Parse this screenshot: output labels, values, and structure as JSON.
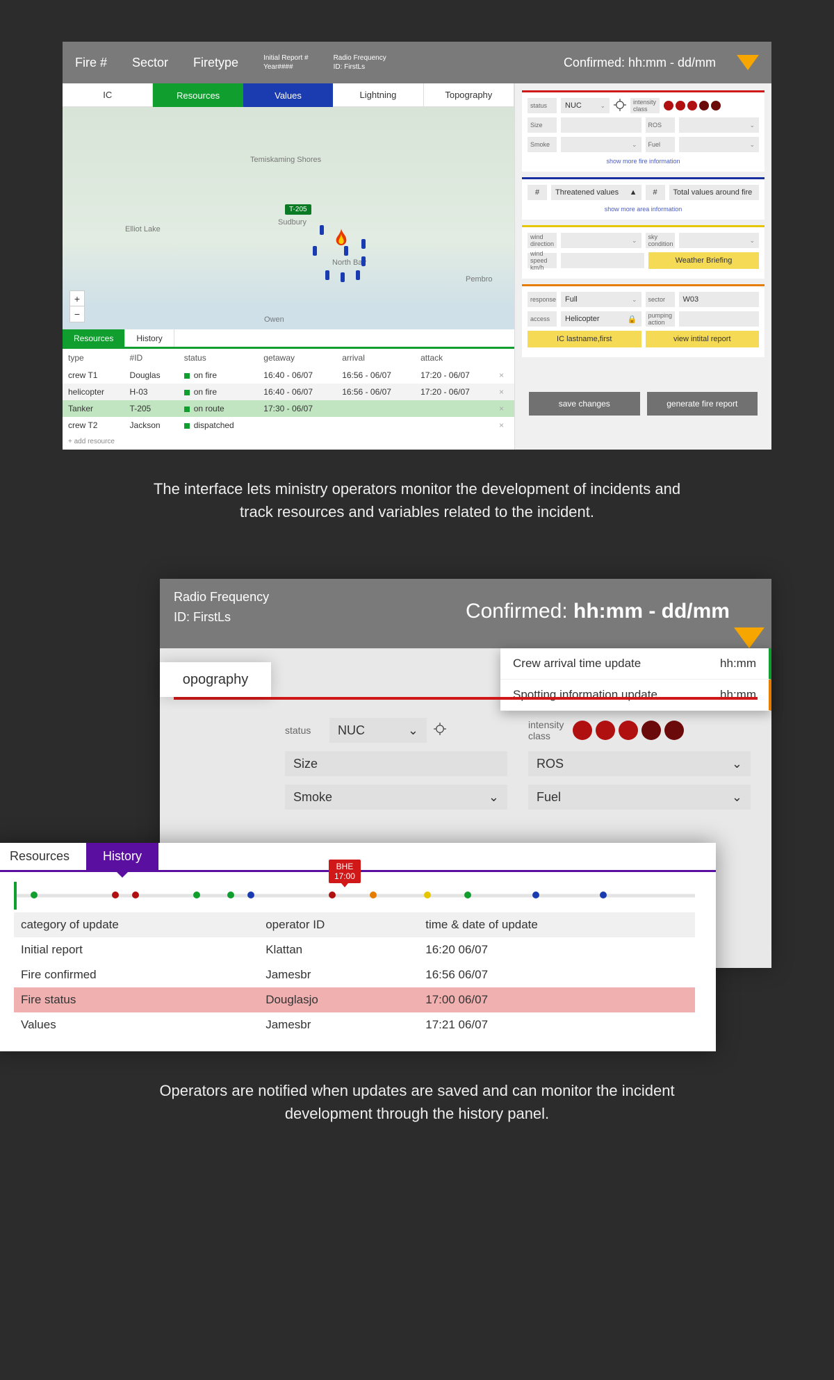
{
  "shot1": {
    "header": {
      "fire": "Fire #",
      "sector": "Sector",
      "firetype": "Firetype",
      "initrep_l1": "Initial Report #",
      "initrep_l2": "Year####",
      "radio_l1": "Radio Frequency",
      "radio_l2": "ID: FirstLs",
      "confirmed": "Confirmed: hh:mm - dd/mm"
    },
    "tabs": [
      "IC",
      "Resources",
      "Values",
      "Lightning",
      "Topography"
    ],
    "map": {
      "temisk": "Temiskaming Shores",
      "sudbury": "Sudbury",
      "elliot": "Elliot Lake",
      "north": "North Bay",
      "pembr": "Pembro",
      "owen": "Owen",
      "tag": "T-205"
    },
    "subtabs": [
      "Resources",
      "History"
    ],
    "columns": [
      "type",
      "#ID",
      "status",
      "getaway",
      "arrival",
      "attack"
    ],
    "rows": [
      {
        "type": "crew T1",
        "id": "Douglas",
        "status": "on fire",
        "getaway": "16:40 - 06/07",
        "arrival": "16:56 - 06/07",
        "attack": "17:20 - 06/07"
      },
      {
        "type": "helicopter",
        "id": "H-03",
        "status": "on fire",
        "getaway": "16:40 - 06/07",
        "arrival": "16:56 - 06/07",
        "attack": "17:20 - 06/07"
      },
      {
        "type": "Tanker",
        "id": "T-205",
        "status": "on route",
        "getaway": "17:30 - 06/07",
        "arrival": "",
        "attack": ""
      },
      {
        "type": "crew T2",
        "id": "Jackson",
        "status": "dispatched",
        "getaway": "",
        "arrival": "",
        "attack": ""
      }
    ],
    "addres": "+ add resource",
    "right": {
      "status_label": "status",
      "status_val": "NUC",
      "intensity_label": "intensity class",
      "size": "Size",
      "ros": "ROS",
      "smoke": "Smoke",
      "fuel": "Fuel",
      "more_fire": "show more fire information",
      "hash": "#",
      "threatened": "Threatened values",
      "total": "Total values around fire",
      "more_area": "show more area information",
      "wind_dir": "wind direction",
      "sky": "sky condition",
      "wind_speed": "wind speed km/h",
      "weather_briefing": "Weather Briefing",
      "response": "response",
      "response_val": "Full",
      "sector": "sector",
      "sector_val": "W03",
      "access": "access",
      "access_val": "Helicopter",
      "pumping": "pumping action",
      "ic": "IC lastname,first",
      "viewrep": "view intital report",
      "save": "save changes",
      "gen": "generate fire report"
    }
  },
  "caption1": "The interface lets ministry operators monitor the development of incidents and track resources and variables related to the incident.",
  "shot2": {
    "radio_l1": "Radio Frequency",
    "radio_l2": "ID: FirstLs",
    "confirmed": "Confirmed: hh:mm - dd/mm",
    "topo": "opography",
    "notif": [
      {
        "t": "Crew arrival time update",
        "v": "hh:mm"
      },
      {
        "t": "Spotting information update",
        "v": "hh:mm"
      }
    ],
    "status_label": "status",
    "status_val": "NUC",
    "intensity_label": "intensity class",
    "size": "Size",
    "ros": "ROS",
    "smoke": "Smoke",
    "fuel": "Fuel",
    "hist": {
      "tabs": [
        "Resources",
        "History"
      ],
      "bhe_l1": "BHE",
      "bhe_l2": "17:00",
      "cols": [
        "category of update",
        "operator ID",
        "time & date of update"
      ],
      "rows": [
        {
          "c": "Initial report",
          "o": "Klattan",
          "t": "16:20 06/07"
        },
        {
          "c": "Fire confirmed",
          "o": "Jamesbr",
          "t": "16:56 06/07"
        },
        {
          "c": "Fire status",
          "o": "Douglasjo",
          "t": "17:00 06/07"
        },
        {
          "c": "Values",
          "o": "Jamesbr",
          "t": "17:21 06/07"
        }
      ],
      "tdots": [
        {
          "x": 2,
          "c": "#109e2f"
        },
        {
          "x": 14,
          "c": "#b01010"
        },
        {
          "x": 17,
          "c": "#b01010"
        },
        {
          "x": 26,
          "c": "#109e2f"
        },
        {
          "x": 31,
          "c": "#109e2f"
        },
        {
          "x": 34,
          "c": "#1a3cb0"
        },
        {
          "x": 46,
          "c": "#b01010"
        },
        {
          "x": 52,
          "c": "#e67c00"
        },
        {
          "x": 60,
          "c": "#e6c600"
        },
        {
          "x": 66,
          "c": "#109e2f"
        },
        {
          "x": 76,
          "c": "#1a3cb0"
        },
        {
          "x": 86,
          "c": "#1a3cb0"
        }
      ]
    }
  },
  "caption2": "Operators are notified when updates are saved and can monitor the incident development through the history panel."
}
